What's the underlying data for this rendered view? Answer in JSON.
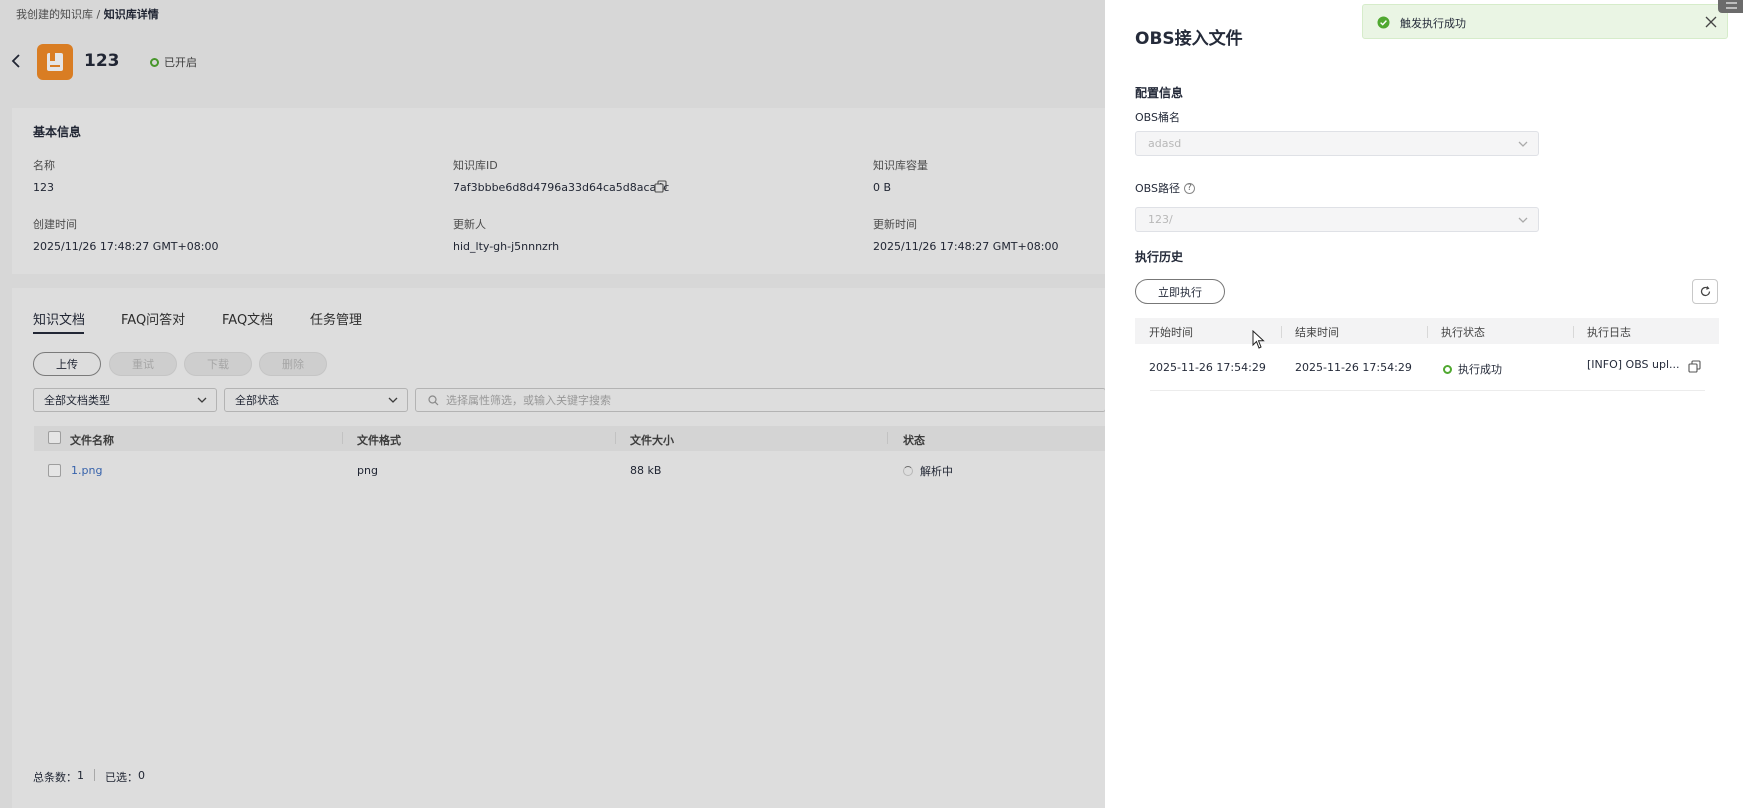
{
  "breadcrumb": {
    "parent": "我创建的知识库",
    "separator": "/",
    "current": "知识库详情"
  },
  "header": {
    "kb_name": "123",
    "status": "已开启"
  },
  "basic_info": {
    "title": "基本信息",
    "fields": [
      {
        "label": "名称",
        "value": "123"
      },
      {
        "label": "知识库ID",
        "value": "7af3bbbe6d8d4796a33d64ca5d8aca4c"
      },
      {
        "label": "知识库容量",
        "value": "0 B"
      },
      {
        "label": "创建时间",
        "value": "2025/11/26 17:48:27 GMT+08:00"
      },
      {
        "label": "更新人",
        "value": "hid_lty-gh-j5nnnzrh"
      },
      {
        "label": "更新时间",
        "value": "2025/11/26 17:48:27 GMT+08:00"
      }
    ]
  },
  "tabs": [
    "知识文档",
    "FAQ问答对",
    "FAQ文档",
    "任务管理"
  ],
  "toolbar": {
    "upload": "上传",
    "retry": "重试",
    "download": "下载",
    "delete": "删除"
  },
  "filters": {
    "doc_type": "全部文档类型",
    "status": "全部状态",
    "search_placeholder": "选择属性筛选，或输入关键字搜索"
  },
  "table": {
    "columns": [
      "文件名称",
      "文件格式",
      "文件大小",
      "状态"
    ],
    "rows": [
      {
        "name": "1.png",
        "format": "png",
        "size": "88 kB",
        "status": "解析中"
      }
    ]
  },
  "footer": {
    "total_label": "总条数：",
    "total": "1",
    "selected_label": "已选：",
    "selected": "0"
  },
  "drawer": {
    "title": "OBS接入文件",
    "config_title": "配置信息",
    "bucket_label": "OBS桶名",
    "bucket_value": "adasd",
    "path_label": "OBS路径",
    "path_value": "123/",
    "history_title": "执行历史",
    "run_now": "立即执行",
    "history_columns": [
      "开始时间",
      "结束时间",
      "执行状态",
      "执行日志"
    ],
    "history_rows": [
      {
        "start": "2025-11-26 17:54:29",
        "end": "2025-11-26 17:54:29",
        "status": "执行成功",
        "log": "[INFO] OBS upl..."
      }
    ]
  },
  "toast": {
    "message": "触发执行成功"
  },
  "colors": {
    "success": "#50a830",
    "accent": "#f28c28",
    "link": "#3d6ebf"
  }
}
